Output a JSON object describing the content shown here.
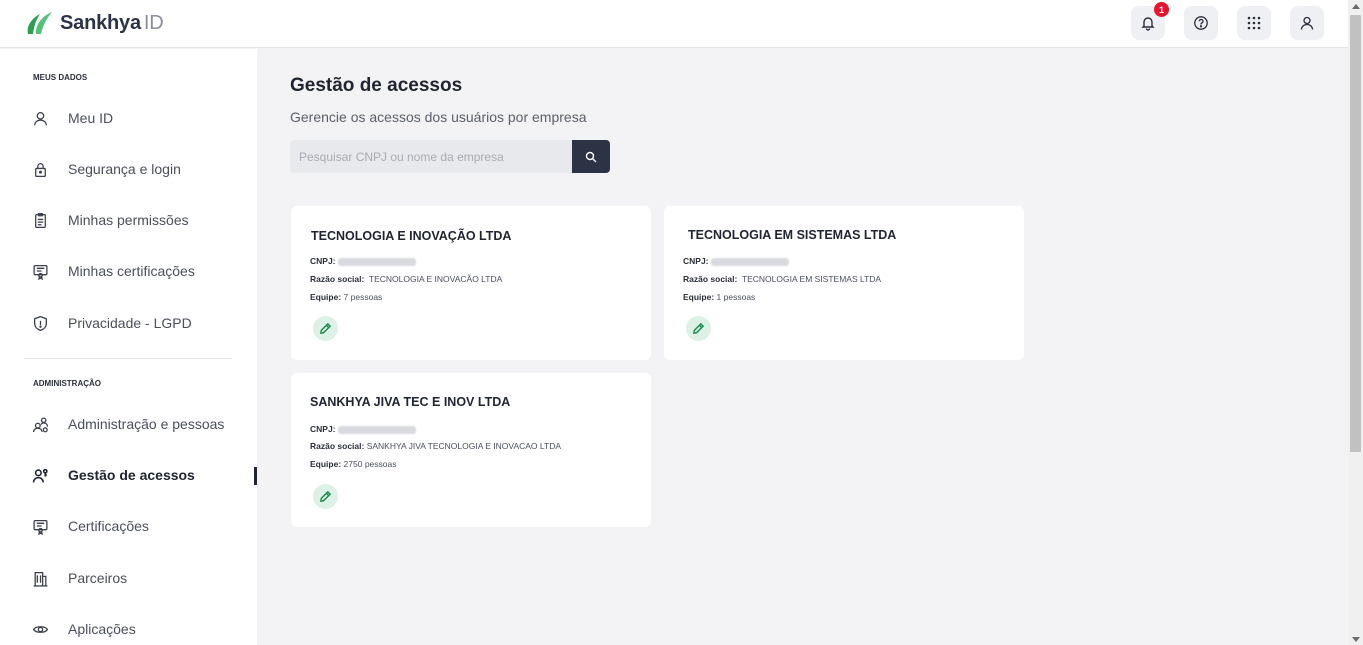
{
  "brand": {
    "name": "Sankhya",
    "suffix": "ID",
    "color_green": "#2e9e55",
    "color_dark": "#2c3344"
  },
  "header": {
    "notifications": {
      "icon": "bell-icon",
      "count": "1"
    },
    "help_icon": "help-circle-icon",
    "apps_icon": "grid-icon",
    "user_icon": "user-icon"
  },
  "sidebar": {
    "section_personal": "MEUS DADOS",
    "section_admin": "ADMINISTRAÇÃO",
    "personal_items": [
      {
        "label": "Meu ID",
        "icon": "user-icon"
      },
      {
        "label": "Segurança e login",
        "icon": "lock-icon"
      },
      {
        "label": "Minhas permissões",
        "icon": "clipboard-icon"
      },
      {
        "label": "Minhas certificações",
        "icon": "certificate-icon"
      },
      {
        "label": "Privacidade - LGPD",
        "icon": "shield-icon"
      }
    ],
    "admin_items": [
      {
        "label": "Administração e pessoas",
        "icon": "people-icon"
      },
      {
        "label": "Gestão de acessos",
        "icon": "user-access-icon",
        "active": true
      },
      {
        "label": "Certificações",
        "icon": "certificate-icon"
      },
      {
        "label": "Parceiros",
        "icon": "building-icon"
      },
      {
        "label": "Aplicações",
        "icon": "eye-icon"
      }
    ]
  },
  "main": {
    "title": "Gestão de acessos",
    "subtitle": "Gerencie os acessos dos usuários por empresa",
    "search": {
      "placeholder": "Pesquisar CNPJ ou nome da empresa",
      "icon": "search-icon"
    },
    "labels": {
      "cnpj": "CNPJ:",
      "razao": "Razão social:",
      "equipe": "Equipe:"
    },
    "companies": [
      {
        "name": "TECNOLOGIA E INOVAÇÃO LTDA",
        "razao_social": "TECNOLOGIA E INOVACÃO LTDA",
        "equipe": "7 pessoas"
      },
      {
        "name": "TECNOLOGIA EM SISTEMAS LTDA",
        "razao_social": "TECNOLOGIA EM SISTEMAS LTDA",
        "equipe": "1 pessoas"
      },
      {
        "name": "SANKHYA JIVA TEC E INOV LTDA",
        "razao_social": "SANKHYA JIVA TECNOLOGIA E INOVACAO LTDA",
        "equipe": "2750 pessoas"
      }
    ]
  }
}
